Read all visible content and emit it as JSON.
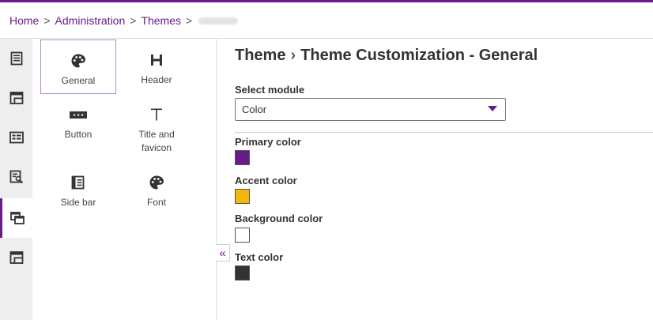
{
  "breadcrumb": {
    "items": [
      "Home",
      "Administration",
      "Themes"
    ],
    "separator": ">"
  },
  "rail": {
    "items": [
      {
        "icon": "document-list-icon"
      },
      {
        "icon": "layout-icon"
      },
      {
        "icon": "dashboard-icon"
      },
      {
        "icon": "inspect-icon"
      },
      {
        "icon": "theme-windows-icon",
        "active": true
      },
      {
        "icon": "table-layout-icon"
      }
    ]
  },
  "tiles": [
    {
      "label": "General",
      "icon": "palette-icon",
      "selected": true
    },
    {
      "label": "Header",
      "icon": "header-h-icon"
    },
    {
      "label": "Button",
      "icon": "button-icon"
    },
    {
      "label": "Title and favicon",
      "icon": "text-t-icon"
    },
    {
      "label": "Side bar",
      "icon": "sidebar-icon"
    },
    {
      "label": "Font",
      "icon": "palette-icon"
    }
  ],
  "collapse_glyph": "«",
  "main": {
    "title_parent": "Theme",
    "title_sep": "›",
    "title_current": "Theme Customization - General",
    "select_module_label": "Select module",
    "select_module_value": "Color",
    "colors": [
      {
        "label": "Primary color",
        "value": "#6a1b8a"
      },
      {
        "label": "Accent color",
        "value": "#f2b70a"
      },
      {
        "label": "Background color",
        "value": "#ffffff"
      },
      {
        "label": "Text color",
        "value": "#333333"
      }
    ]
  },
  "theme": {
    "accent_purple": "#6a1b8a",
    "rail_bg": "#eeeeee"
  }
}
